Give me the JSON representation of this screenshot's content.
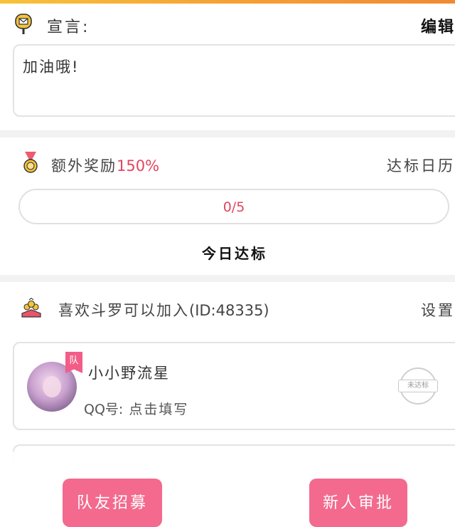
{
  "declaration": {
    "label": "宣言:",
    "edit_label": "编辑",
    "text": "加油哦!"
  },
  "bonus": {
    "label": "额外奖励",
    "value": "150%",
    "calendar_label": "达标日历",
    "progress_text": "0/5",
    "progress_fraction": 0,
    "today_label": "今日达标"
  },
  "team": {
    "name": "喜欢斗罗可以加入",
    "id_text": "(ID:48335)",
    "settings_label": "设置",
    "members": [
      {
        "badge": "队",
        "name": "小小野流星",
        "qq_label": "QQ号:",
        "qq_value": "点击填写",
        "status": "未达标"
      }
    ]
  },
  "buttons": {
    "recruit": "队友招募",
    "approve": "新人审批"
  },
  "colors": {
    "accent": "#f36a8e",
    "highlight": "#e2455f",
    "topbar": "#f7a135"
  }
}
